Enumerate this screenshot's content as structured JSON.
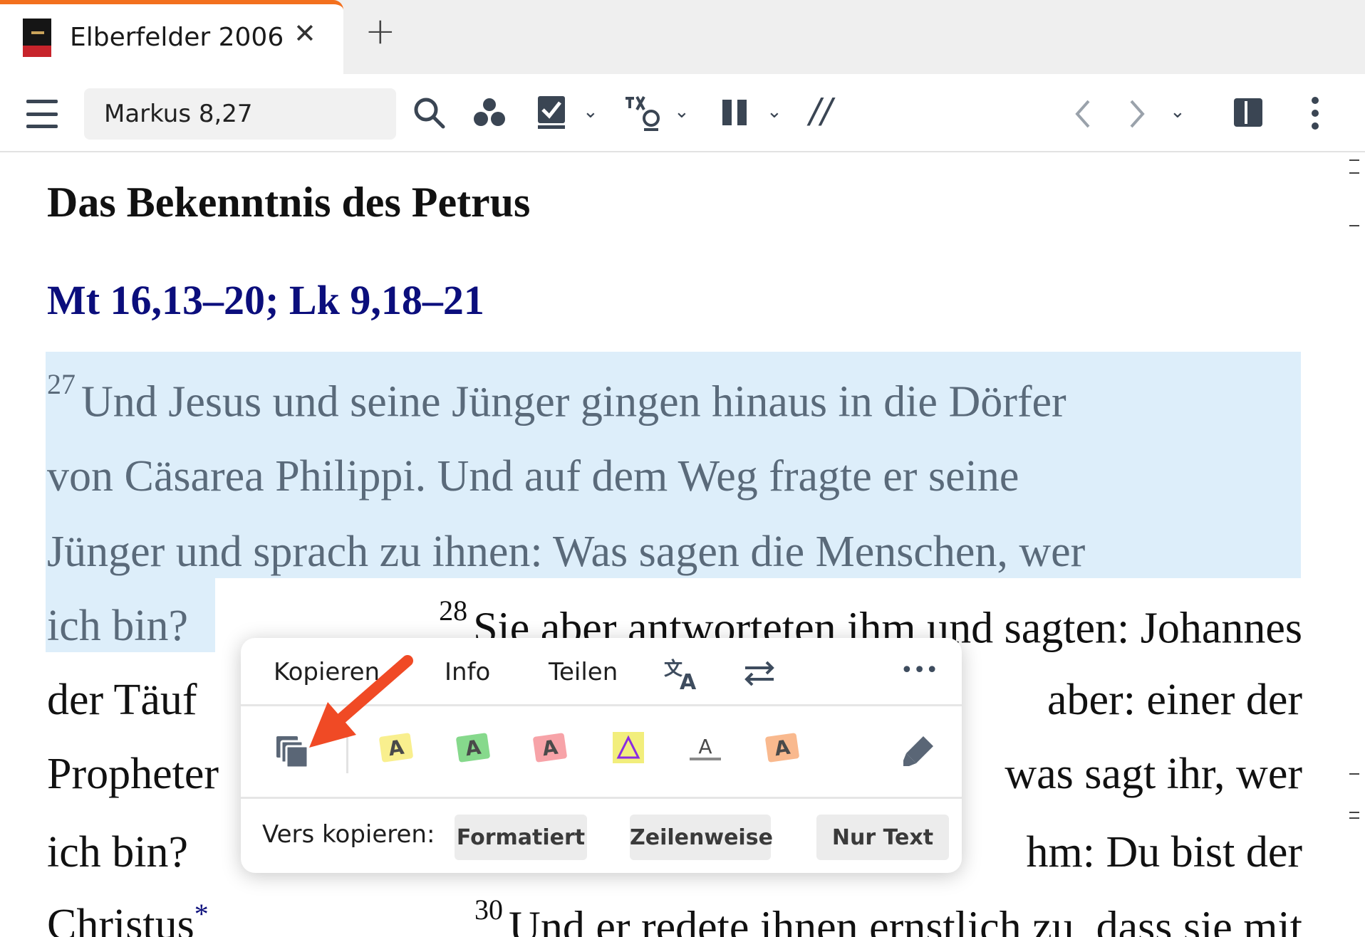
{
  "tab": {
    "title": "Elberfelder 2006",
    "close": "✕",
    "add": "+"
  },
  "toolbar": {
    "reference_value": "Markus 8,27",
    "parallel_label": "//",
    "icons": [
      "menu-icon",
      "search-icon",
      "dots-cluster-icon",
      "checkbox-book-icon",
      "chevron-down-icon",
      "strongs-icon",
      "chevron-down-icon",
      "columns-icon",
      "chevron-down-icon",
      "parallel-icon",
      "back-icon",
      "forward-icon",
      "chevron-down-icon",
      "split-view-icon",
      "more-vertical-icon"
    ]
  },
  "content": {
    "heading": "Das Bekenntnis des Petrus",
    "ref1": "Mt 16,13–20",
    "ref_sep": ";",
    "ref2": "Lk 9,18–21",
    "v27_num": "27",
    "line1": "Und Jesus und seine Jünger gingen hinaus in die Dörfer",
    "line2": "von Cäsarea Philippi. Und auf dem Weg fragte er seine",
    "line3": "Jünger und sprach zu ihnen: Was sagen die Menschen, wer",
    "line4_a": "ich bin?",
    "v28_num": "28",
    "line4_b": "Sie aber antworteten ihm und sagten: Johannes",
    "line5_a": "der Täuf",
    "line5_b": "aber: einer der",
    "line6_a": "Propheter",
    "line6_b": "was sagt ihr, wer",
    "line7_a": "ich bin? ",
    "line7_b": "hm: Du bist der",
    "line8_a": "Christus",
    "star": "*",
    "v30_num": "30",
    "line8_b": "Und er redete ihnen ernstlich zu, dass sie mit"
  },
  "popup": {
    "tabs": {
      "copy": "Kopieren",
      "info": "Info",
      "share": "Teilen"
    },
    "more": "•••",
    "highlight_letter": "A",
    "highlight_colors": [
      "#f9ef8e",
      "#86d98c",
      "#f7a3a8",
      "#f2ee7c",
      "#ffffff",
      "#f9b98e"
    ],
    "accent_colors": {
      "triangle": "#8a2be2",
      "arrow": "#f04a25",
      "verse_blue": "#0b0e7c",
      "selection": "#ddeefa"
    },
    "copy_label": "Vers kopieren:",
    "buttons": {
      "formatted": "Formatiert",
      "linewise": "Zeilenweise",
      "text_only": "Nur Text"
    }
  }
}
